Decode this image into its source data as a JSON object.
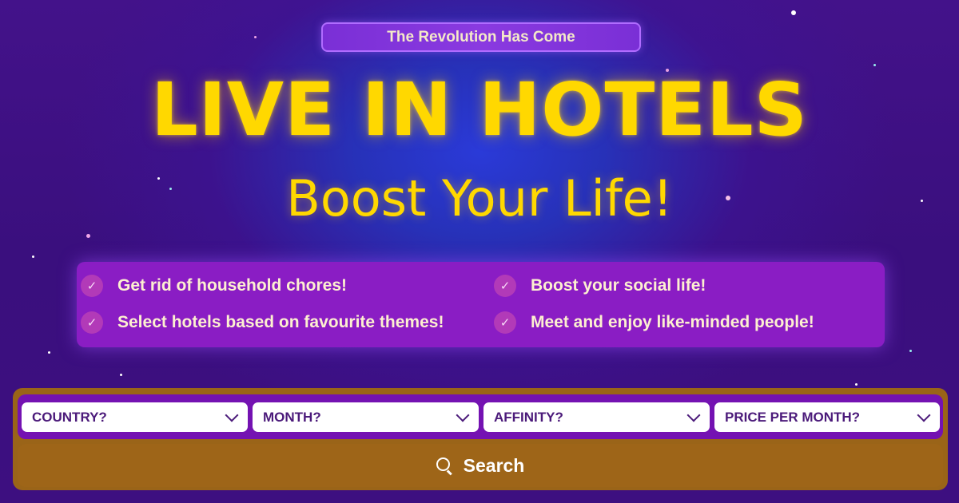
{
  "hero": {
    "badge": "The Revolution Has Come",
    "title": "LIVE IN HOTELS",
    "subtitle": "Boost Your Life!"
  },
  "features": [
    {
      "label": "Get rid of household chores!",
      "icon": "check-icon"
    },
    {
      "label": "Select hotels based on favourite themes!",
      "icon": "check-icon"
    },
    {
      "label": "Boost your social life!",
      "icon": "check-icon"
    },
    {
      "label": "Meet and enjoy like-minded people!",
      "icon": "check-icon"
    }
  ],
  "search": {
    "filters": [
      {
        "label": "COUNTRY?",
        "icon": "chevron-down-icon"
      },
      {
        "label": "MONTH?",
        "icon": "chevron-down-icon"
      },
      {
        "label": "AFFINITY?",
        "icon": "chevron-down-icon"
      },
      {
        "label": "PRICE PER MONTH?",
        "icon": "chevron-down-icon"
      }
    ],
    "button_label": "Search",
    "button_icon": "search-icon"
  },
  "colors": {
    "background": "#3b0d78",
    "title": "#ffd800",
    "features_panel": "#8a1dc4",
    "search_panel": "#9a6418",
    "search_row": "#7412b2"
  }
}
